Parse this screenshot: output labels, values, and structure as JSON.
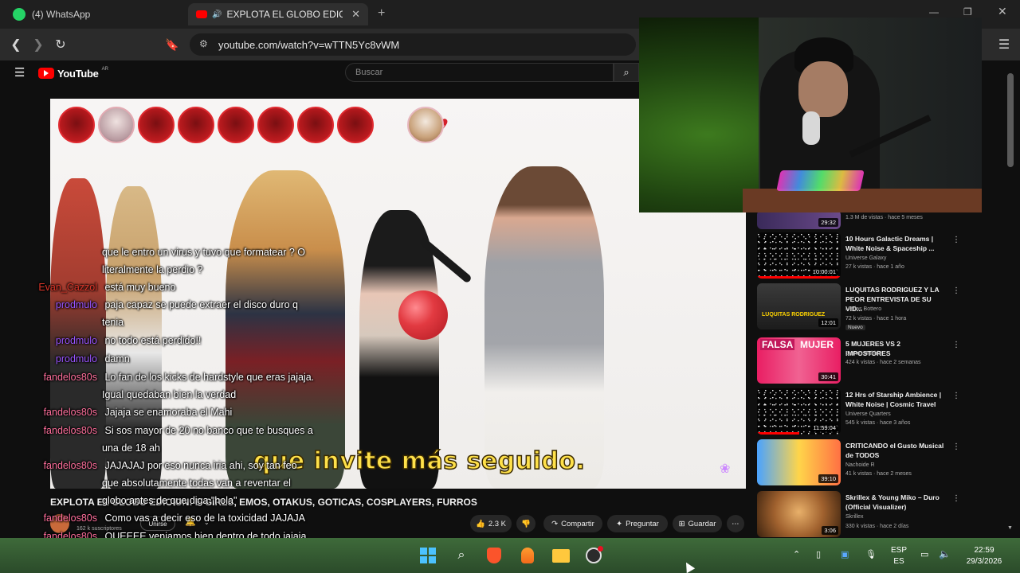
{
  "tabs": [
    {
      "title": "(4) WhatsApp",
      "active": false
    },
    {
      "title": "EXPLOTA EL GLOBO EDICION",
      "active": true
    }
  ],
  "url": "youtube.com/watch?v=wTTN5Yc8vWM",
  "youtube": {
    "logo_text": "YouTube",
    "country_code": "AR",
    "search_placeholder": "Buscar"
  },
  "video": {
    "subtitle": "que invite más seguido.",
    "title": "EXPLOTA EL GLOBO EDICION: E-GIRLS, EMOS, OTAKUS, GOTICAS, COSPLAYERS, FURROS",
    "channel_subscribers": "162 k suscriptores",
    "join_label": "Unirse",
    "likes": "2.3 K",
    "share_label": "Compartir",
    "ask_label": "Preguntar",
    "save_label": "Guardar"
  },
  "chat": [
    {
      "user": "",
      "message": "que le entro un virus y tuvo que formatear ? O",
      "color": "#ffffff"
    },
    {
      "user": "",
      "message": "literalmente la perdio ?",
      "color": "#ffffff"
    },
    {
      "user": "Evan_Cazzol",
      "message": "está muy bueno",
      "color": "#e0372a"
    },
    {
      "user": "prodmulo",
      "message": "paja capaz se puede extraer el disco duro q",
      "color": "#9a55ff"
    },
    {
      "user": "",
      "message": "tenia",
      "color": "#ffffff"
    },
    {
      "user": "prodmulo",
      "message": "no todo está perdido!!",
      "color": "#9a55ff"
    },
    {
      "user": "prodmulo",
      "message": "damn",
      "color": "#9a55ff"
    },
    {
      "user": "fandelos80s",
      "message": "Lo fan de los kicks de hardstyle que eras jajaja.",
      "color": "#ff6f9c"
    },
    {
      "user": "",
      "message": "Igual quedaban bien la verdad",
      "color": "#ffffff"
    },
    {
      "user": "fandelos80s",
      "message": "Jajaja se enamoraba el Mahi",
      "color": "#ff6f9c"
    },
    {
      "user": "fandelos80s",
      "message": "Si sos mayor de 20 no banco que te busques a",
      "color": "#ff6f9c"
    },
    {
      "user": "",
      "message": "una de 18 ah",
      "color": "#ffffff"
    },
    {
      "user": "fandelos80s",
      "message": "JAJAJAJ por eso nunca iria ahi, soy tan feo",
      "color": "#ff6f9c"
    },
    {
      "user": "",
      "message": "que absolutamente todas van a reventar el",
      "color": "#ffffff"
    },
    {
      "user": "",
      "message": "globo antes de que diga \"hola\"",
      "color": "#ffffff"
    },
    {
      "user": "fandelos80s",
      "message": "Como vas a decir eso de la toxicidad JAJAJA",
      "color": "#ff6f9c"
    },
    {
      "user": "fandelos80s",
      "message": "QUEEEE,veniamos bien dentro de todo jajaja",
      "color": "#ff6f9c"
    }
  ],
  "recommendations": [
    {
      "title": "",
      "channel": "",
      "meta": "1.3 M de vistas · hace 5 meses",
      "duration": "29:32",
      "badge": ""
    },
    {
      "title": "10 Hours Galactic Dreams | White Noise & Spaceship ...",
      "channel": "Universe Galaxy",
      "meta": "27 k vistas · hace 1 año",
      "duration": "10:00:01",
      "badge": ""
    },
    {
      "title": "LUQUITAS RODRIGUEZ Y LA PEOR ENTREVISTA DE SU VID...",
      "channel": "Matias Bottero",
      "meta": "72 k vistas · hace 1 hora",
      "duration": "12:01",
      "badge": "Nuevo"
    },
    {
      "title": "5 MUJERES VS 2 IMPOSTORES",
      "channel": "Somos Bubble",
      "meta": "424 k vistas · hace 2 semanas",
      "duration": "30:41",
      "badge": ""
    },
    {
      "title": "12 Hrs of Starship Ambience | White Noise | Cosmic Travel",
      "channel": "Universe Quarters",
      "meta": "545 k vistas · hace 3 años",
      "duration": "11:59:04",
      "badge": ""
    },
    {
      "title": "CRITICANDO el Gusto Musical de TODOS",
      "channel": "Nachoide R",
      "meta": "41 k vistas · hace 2 meses",
      "duration": "39:10",
      "badge": ""
    },
    {
      "title": "Skrillex & Young Miko – Duro (Official Visualizer)",
      "channel": "Skrillex",
      "meta": "330 k vistas · hace 2 días",
      "duration": "3:06",
      "badge": ""
    }
  ],
  "taskbar": {
    "lang_top": "ESP",
    "lang_bottom": "ES",
    "time": "22:59",
    "date": "29/3/2026"
  },
  "colors": {
    "youtube_red": "#ff0000",
    "balloon_red": "#d42227",
    "subtitle_yellow": "#ffe14a"
  }
}
